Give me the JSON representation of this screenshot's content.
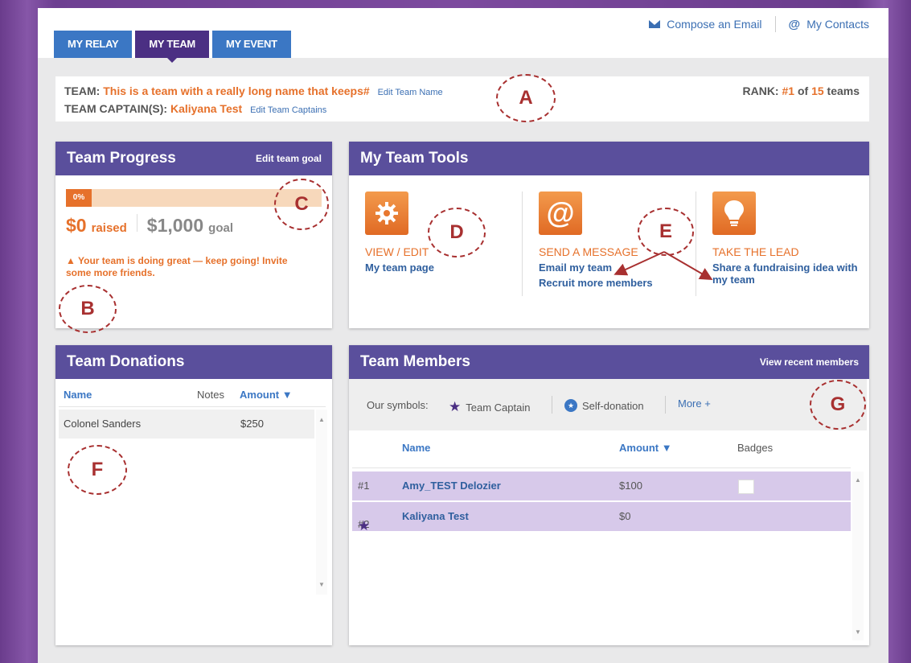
{
  "header": {
    "tabs": [
      "MY RELAY",
      "MY TEAM",
      "MY EVENT"
    ],
    "compose_email": "Compose an Email",
    "my_contacts": "My Contacts"
  },
  "team_info": {
    "team_label": "TEAM:",
    "team_name": "This is a team with a really long name that keeps#",
    "edit_team_name": "Edit Team Name",
    "captain_label": "TEAM CAPTAIN(S):",
    "captain_name": "Kaliyana Test",
    "edit_captains": "Edit Team Captains",
    "rank_label": "RANK:",
    "rank_value": "#1",
    "rank_of": "of",
    "rank_total": "15",
    "rank_suffix": "teams"
  },
  "progress": {
    "title": "Team Progress",
    "edit_goal": "Edit team goal",
    "percent": "0%",
    "raised_amount": "$0",
    "raised_label": "raised",
    "goal_amount": "$1,000",
    "goal_label": "goal",
    "message": "Your team is doing great — keep going! Invite some more friends."
  },
  "tools": {
    "title": "My Team Tools",
    "items": [
      {
        "title": "VIEW / EDIT",
        "links": [
          "My team page"
        ]
      },
      {
        "title": "SEND A MESSAGE",
        "links": [
          "Email my team",
          "Recruit more members"
        ]
      },
      {
        "title": "TAKE THE LEAD",
        "links": [
          "Share a fundraising idea with my team"
        ]
      }
    ]
  },
  "donations": {
    "title": "Team Donations",
    "columns": {
      "name": "Name",
      "notes": "Notes",
      "amount": "Amount ▼"
    },
    "rows": [
      {
        "name": "Colonel Sanders",
        "amount": "$250"
      }
    ]
  },
  "members": {
    "title": "Team Members",
    "view_recent": "View recent members",
    "symbols_label": "Our symbols:",
    "symbol_captain": "Team Captain",
    "symbol_self": "Self-donation",
    "more": "More +",
    "columns": {
      "name": "Name",
      "amount": "Amount ▼",
      "badges": "Badges"
    },
    "rows": [
      {
        "rank": "#1",
        "name": "Amy_TEST Delozier",
        "amount": "$100"
      },
      {
        "rank": "#2",
        "name": "Kaliyana Test",
        "amount": "$0"
      }
    ]
  },
  "annotations": [
    "A",
    "B",
    "C",
    "D",
    "E",
    "F",
    "G"
  ],
  "colors": {
    "accent_orange": "#e6712b",
    "panel_header": "#5a4f9c",
    "tab_blue": "#3b77c4",
    "tab_active": "#4b2f83",
    "annotation_red": "#a83030"
  }
}
